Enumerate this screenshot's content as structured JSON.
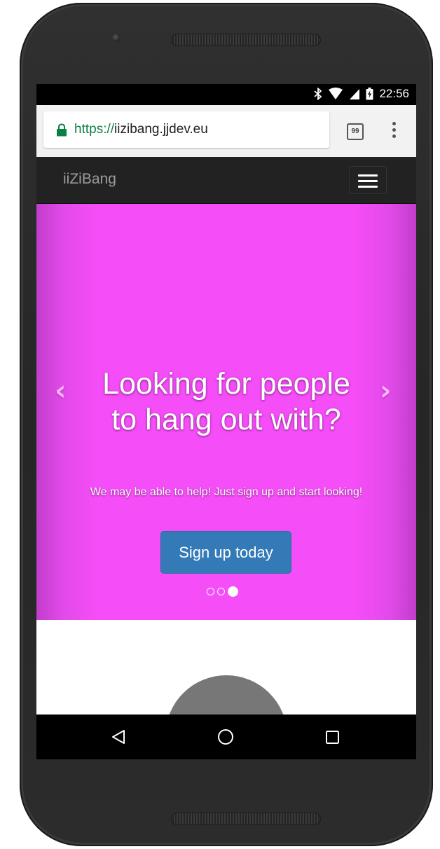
{
  "status_bar": {
    "time": "22:56",
    "icons": [
      "bluetooth-icon",
      "wifi-icon",
      "signal-icon",
      "battery-charging-icon"
    ]
  },
  "browser": {
    "url_scheme": "https://",
    "url_host": "iizibang.jjdev.eu",
    "tab_count": "99",
    "icons": [
      "lock-icon",
      "tabs-icon",
      "overflow-menu-icon"
    ]
  },
  "navbar": {
    "brand": "iiZiBang",
    "icons": [
      "hamburger-icon"
    ]
  },
  "hero": {
    "title": "Looking for people to hang out with?",
    "subtitle": "We may be able to help! Just sign up and start looking!",
    "button_label": "Sign up today",
    "prev_arrow": "‹",
    "next_arrow": "›",
    "slide_count": 3,
    "active_slide": 3,
    "background_color": "#f54df8",
    "button_color": "#337ab7"
  },
  "system_nav": {
    "icons": [
      "back-icon",
      "home-icon",
      "recents-icon"
    ]
  }
}
